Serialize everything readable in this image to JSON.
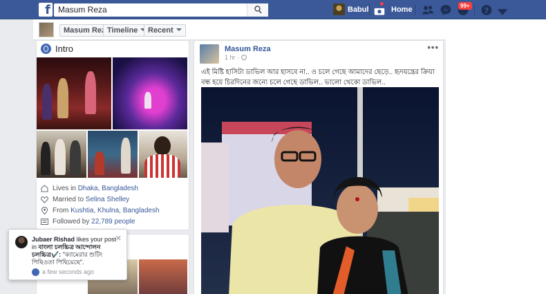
{
  "topbar": {
    "search_value": "Masum Reza",
    "user_name": "Babul",
    "home_label": "Home",
    "notification_count": "99+"
  },
  "subnav": {
    "profile_name": "Masum Reza",
    "timeline_label": "Timeline",
    "recent_label": "Recent"
  },
  "intro": {
    "title": "Intro",
    "lives_prefix": "Lives in",
    "lives_place": "Dhaka, Bangladesh",
    "married_prefix": "Married to",
    "married_name": "Selina Shelley",
    "from_prefix": "From",
    "from_place": "Kushtia, Khulna, Bangladesh",
    "followed_prefix": "Followed by",
    "followed_count": "22,789 people"
  },
  "post": {
    "author": "Masum Reza",
    "time": "1 hr ·",
    "text": "এই মিষ্টি হাসিটা ডাভিল আর হাসবে না.. ও চলে গেছে আমাদের ছেড়ে.. হৃদযন্ত্রের ক্রিয়া বন্ধ হয়ে চিরদিনের জন্যে চলে গেছে ডাভিল.. ভালো থেকো ডাভিল.."
  },
  "toast": {
    "actor": "Jubaer Rishad",
    "action": "likes your post in",
    "group": "বাংলা চলচ্চিত্র আন্দোলন চলচ্চিত্র✔️:",
    "quote": "\"ক্যামেরার শুটিং পিছিওতা পিছিয়েছে\".",
    "time": "a few seconds ago"
  },
  "colors": {
    "brand_blue": "#3b5998",
    "link_blue": "#365899",
    "badge_red": "#fa3e3e",
    "background": "#e9ebee"
  },
  "icons": {
    "logo": "facebook-logo-icon",
    "search": "search-icon",
    "friends": "friend-requests-icon",
    "messages": "messenger-icon",
    "notifications": "globe-notifications-icon",
    "help": "help-icon",
    "menu": "chevron-down-icon"
  }
}
